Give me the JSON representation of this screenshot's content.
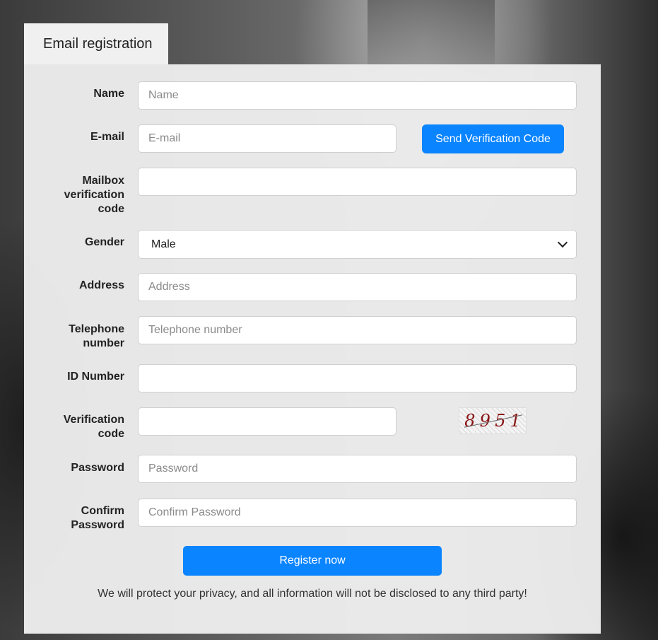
{
  "tab": {
    "label": "Email registration"
  },
  "form": {
    "name": {
      "label": "Name",
      "placeholder": "Name"
    },
    "email": {
      "label": "E-mail",
      "placeholder": "E-mail",
      "send_button": "Send Verification Code"
    },
    "mailbox_code": {
      "label_lines": [
        "Mailbox",
        "verification",
        "code"
      ],
      "placeholder": ""
    },
    "gender": {
      "label": "Gender",
      "selected": "Male"
    },
    "address": {
      "label": "Address",
      "placeholder": "Address"
    },
    "telephone": {
      "label_lines": [
        "Telephone",
        "number"
      ],
      "placeholder": "Telephone number"
    },
    "id_number": {
      "label": "ID Number",
      "placeholder": ""
    },
    "verification": {
      "label_lines": [
        "Verification",
        "code"
      ],
      "placeholder": "",
      "captcha_chars": [
        "8",
        "9",
        "5",
        "1"
      ]
    },
    "password": {
      "label": "Password",
      "placeholder": "Password"
    },
    "confirm_password": {
      "label_lines": [
        "Confirm",
        "Password"
      ],
      "placeholder": "Confirm Password"
    },
    "register_button": "Register now",
    "notice": "We will protect your privacy, and all information will not be disclosed to any third party!"
  },
  "colors": {
    "accent": "#0a84ff",
    "panel": "#ececec",
    "captcha_text": "#8b1515"
  },
  "icons": {
    "select_arrow": "chevron-down-icon"
  }
}
